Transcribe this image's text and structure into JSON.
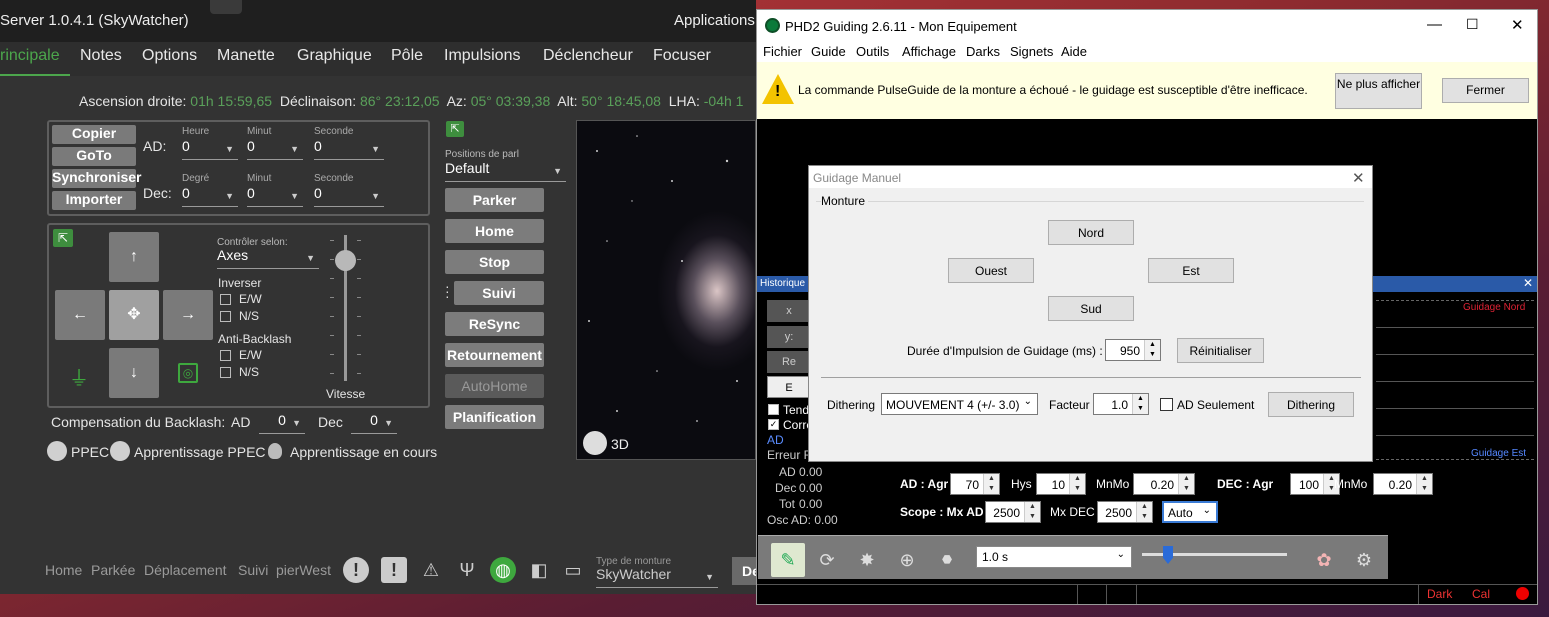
{
  "server": {
    "title": "Server 1.0.4.1 (SkyWatcher)",
    "applications": "Applications",
    "tabs": [
      "rincipale",
      "Notes",
      "Options",
      "Manette",
      "Graphique",
      "Pôle",
      "Impulsions",
      "Déclencheur",
      "Focuser"
    ],
    "coords": {
      "ra_label": "Ascension droite:",
      "ra": "01h 15:59,65",
      "dec_label": "Déclinaison:",
      "dec": "86° 23:12,05",
      "az_label": "Az:",
      "az": "05° 03:39,38",
      "alt_label": "Alt:",
      "alt": "50° 18:45,08",
      "lha_label": "LHA:",
      "lha": "-04h 1"
    },
    "actions": [
      "Copier",
      "GoTo",
      "Synchroniser",
      "Importer"
    ],
    "ad_label": "AD:",
    "dec_label": "Dec:",
    "ad_fields": [
      {
        "label": "Heure",
        "value": "0"
      },
      {
        "label": "Minut",
        "value": "0"
      },
      {
        "label": "Seconde",
        "value": "0"
      }
    ],
    "dec_fields": [
      {
        "label": "Degré",
        "value": "0"
      },
      {
        "label": "Minut",
        "value": "0"
      },
      {
        "label": "Seconde",
        "value": "0"
      }
    ],
    "control_label": "Contrôler selon:",
    "control_value": "Axes",
    "inverser": "Inverser",
    "ew": "E/W",
    "ns": "N/S",
    "antibacklash": "Anti-Backlash",
    "vitesse": "Vitesse",
    "backlash_label": "Compensation du Backlash:",
    "backlash_ad_label": "AD",
    "backlash_ad": "0",
    "backlash_dec_label": "Dec",
    "backlash_dec": "0",
    "ppec": "PPEC",
    "ppec_learn": "Apprentissage PPEC",
    "ppec_running": "Apprentissage en cours",
    "park_label": "Positions de parl",
    "park_value": "Default",
    "right_buttons": [
      "Parker",
      "Home",
      "Stop",
      "Suivi",
      "ReSync",
      "Retournement",
      "AutoHome",
      "Planification"
    ],
    "view3d": "3D",
    "status": [
      "Home",
      "Parkée",
      "Déplacement",
      "Suivi",
      "pierWest"
    ],
    "mount_type_label": "Type de monture",
    "mount_type": "SkyWatcher",
    "cut_btn": "De"
  },
  "phd": {
    "title": "PHD2 Guiding 2.6.11 - Mon Equipement",
    "menu": [
      "Fichier",
      "Guide",
      "Outils",
      "Affichage",
      "Darks",
      "Signets",
      "Aide"
    ],
    "alert": "La commande PulseGuide de la monture a échoué - le guidage est susceptible d'être inefficace.",
    "alert_btn1": "Ne plus afficher",
    "alert_btn2": "Fermer",
    "history": "Historique",
    "left_labels": [
      "x",
      "y:",
      "Re",
      "E"
    ],
    "tendance": "Tenda",
    "corr": "Corre",
    "ad": "AD",
    "erreur": "Erreur R",
    "stats": [
      {
        "label": "AD",
        "value": "0.00"
      },
      {
        "label": "Dec",
        "value": "0.00"
      },
      {
        "label": "Tot",
        "value": "0.00"
      }
    ],
    "osc": "Osc AD: 0.00",
    "guide_nord": "Guidage Nord",
    "guide_est": "Guidage Est",
    "ad_agr_label": "AD : Agr",
    "ad_agr": "70",
    "hys_label": "Hys",
    "hys": "10",
    "mnmo_label": "MnMo",
    "mnmo": "0.20",
    "dec_agr_label": "DEC : Agr",
    "dec_agr": "100",
    "mnmo2_label": "MnMo",
    "mnmo2": "0.20",
    "scope_label": "Scope : Mx AD",
    "mxad": "2500",
    "mxdec_label": "Mx DEC",
    "mxdec": "2500",
    "auto": "Auto",
    "exposure": "1.0 s",
    "statusbar": [
      "Dark",
      "Cal"
    ]
  },
  "dialog": {
    "title": "Guidage Manuel",
    "group": "Monture",
    "nord": "Nord",
    "ouest": "Ouest",
    "est": "Est",
    "sud": "Sud",
    "duration_label": "Durée d'Impulsion de Guidage (ms) :",
    "duration": "950",
    "reset": "Réinitialiser",
    "dithering_label": "Dithering",
    "dithering_mode": "MOUVEMENT 4 (+/- 3.0)",
    "facteur_label": "Facteur",
    "facteur": "1.0",
    "ad_only": "AD Seulement",
    "dithering_btn": "Dithering"
  }
}
